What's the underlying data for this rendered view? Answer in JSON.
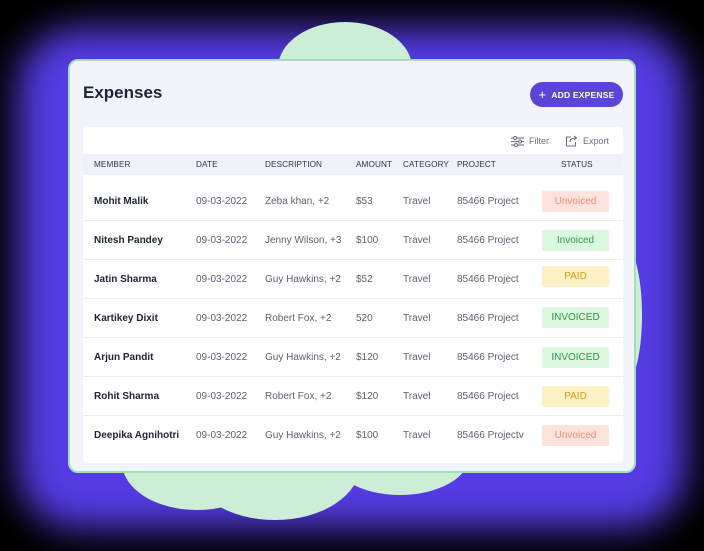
{
  "page": {
    "title": "Expenses"
  },
  "actions": {
    "add_expense": "ADD EXPENSE",
    "filter": "Filter",
    "export": "Export"
  },
  "table": {
    "columns": [
      "MEMBER",
      "DATE",
      "DESCRIPTION",
      "AMOUNT",
      "CATEGORY",
      "PROJECT",
      "STATUS"
    ],
    "rows": [
      {
        "member": "Mohit Malik",
        "date": "09-03-2022",
        "description": "Zeba khan, +2",
        "amount": "$53",
        "category": "Travel",
        "project": "85466 Project",
        "status": "Unvoiced",
        "status_kind": "uninvoiced"
      },
      {
        "member": "Nitesh Pandey",
        "date": "09-03-2022",
        "description": "Jenny Wilson, +3",
        "amount": "$100",
        "category": "Travel",
        "project": "85466 Project",
        "status": "Invoiced",
        "status_kind": "invoiced"
      },
      {
        "member": "Jatin Sharma",
        "date": "09-03-2022",
        "description": "Guy Hawkins, +2",
        "amount": "$52",
        "category": "Travel",
        "project": "85466 Project",
        "status": "PAID",
        "status_kind": "paid"
      },
      {
        "member": "Kartikey Dixit",
        "date": "09-03-2022",
        "description": "Robert Fox, +2",
        "amount": "520",
        "category": "Travel",
        "project": "85466 Project",
        "status": "INVOICED",
        "status_kind": "invoiced"
      },
      {
        "member": "Arjun Pandit",
        "date": "09-03-2022",
        "description": "Guy Hawkins, +2",
        "amount": "$120",
        "category": "Travel",
        "project": "85466 Project",
        "status": "INVOICED",
        "status_kind": "invoiced"
      },
      {
        "member": "Rohit Sharma",
        "date": "09-03-2022",
        "description": "Robert Fox, +2",
        "amount": "$120",
        "category": "Travel",
        "project": "85466 Project",
        "status": "PAID",
        "status_kind": "paid"
      },
      {
        "member": "Deepika Agnihotri",
        "date": "09-03-2022",
        "description": "Guy Hawkins, +2",
        "amount": "$100",
        "category": "Travel",
        "project": "85466 Projectv",
        "status": "Unvoiced",
        "status_kind": "uninvoiced"
      }
    ]
  },
  "colors": {
    "accent": "#5b45d9",
    "glow": "#5a3ff0",
    "blob": "#cdeed6"
  },
  "icons": {
    "add": "plus-icon",
    "filter": "sliders-icon",
    "export": "export-icon"
  }
}
